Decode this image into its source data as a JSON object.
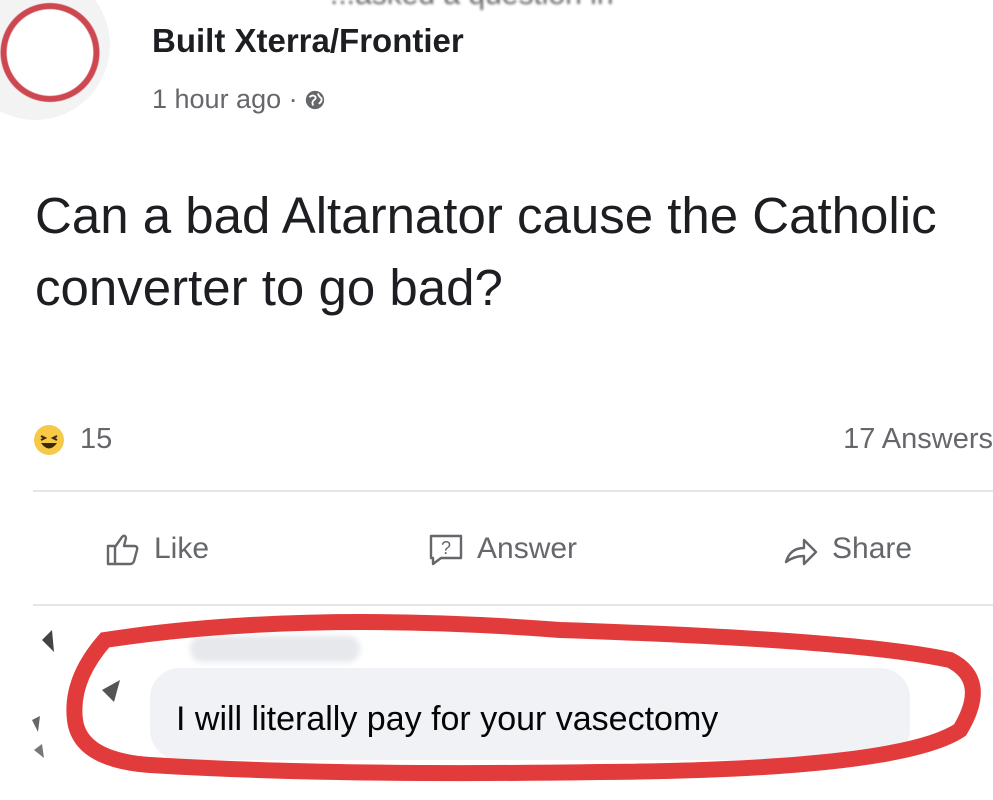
{
  "post": {
    "header_partial": "...asked a question in",
    "group_name": "Built Xterra/Frontier",
    "timestamp": "1 hour ago ·",
    "question": "Can a bad Altarnator cause the Catholic converter to go bad?",
    "reaction_count": "15",
    "answers_count": "17 Answers"
  },
  "actions": {
    "like_label": "Like",
    "answer_label": "Answer",
    "share_label": "Share"
  },
  "comment": {
    "text": "I will literally pay for your vasectomy",
    "highlight_color": "#e23b3b"
  },
  "icons": {
    "reaction": "haha-emoji-icon",
    "privacy": "globe-icon",
    "like": "thumbs-up-icon",
    "answer": "question-bubble-icon",
    "share": "share-arrow-icon"
  }
}
